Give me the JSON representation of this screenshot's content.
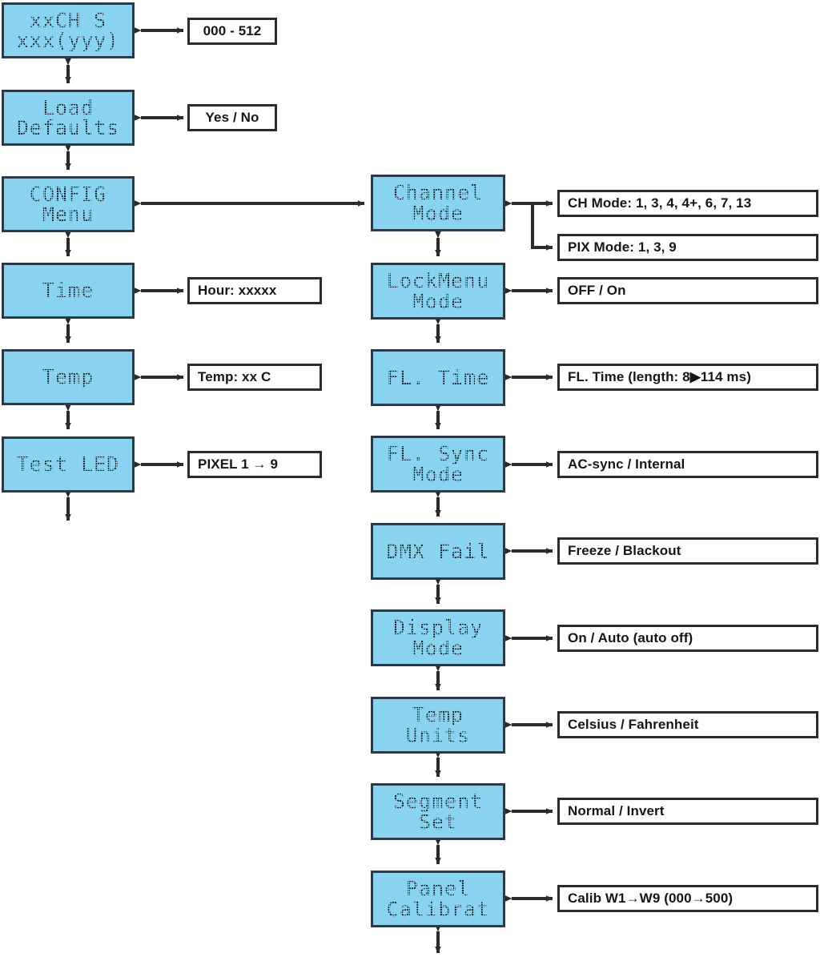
{
  "diagram": {
    "title": "DMX LED panel menu navigation map",
    "colors": {
      "lcd_fill": "#87d3f0",
      "lcd_border": "#2b3a46",
      "lcd_text": "#1d2630",
      "value_border": "#2b2b2b",
      "value_text": "#161616",
      "wire": "#2b2b2b",
      "background": "#ffffff"
    },
    "left_column": [
      {
        "id": "dmx-address",
        "lines": [
          "xxCH S",
          "xxx(yyy)"
        ],
        "value": "000 - 512",
        "value_align": "center"
      },
      {
        "id": "load-defaults",
        "lines": [
          "Load",
          "Defaults"
        ],
        "value": "Yes / No",
        "value_align": "center"
      },
      {
        "id": "config-menu",
        "lines": [
          "CONFIG",
          "Menu"
        ],
        "value": null,
        "value_align": null
      },
      {
        "id": "time",
        "lines": [
          "Time"
        ],
        "value": "Hour: xxxxx",
        "value_align": "left"
      },
      {
        "id": "temp",
        "lines": [
          "Temp"
        ],
        "value": "Temp: xx C",
        "value_align": "left"
      },
      {
        "id": "test-led",
        "lines": [
          "Test LED"
        ],
        "value": "PIXEL 1 → 9",
        "value_align": "left"
      }
    ],
    "right_column": [
      {
        "id": "channel-mode",
        "lines": [
          "Channel",
          "Mode"
        ],
        "values": [
          "CH Mode: 1, 3, 4, 4+, 6, 7, 13",
          "PIX Mode: 1, 3, 9"
        ]
      },
      {
        "id": "lockmenu-mode",
        "lines": [
          "LockMenu",
          "Mode"
        ],
        "values": [
          "OFF / On"
        ]
      },
      {
        "id": "fl-time",
        "lines": [
          "FL. Time"
        ],
        "values": [
          "FL. Time (length: 8▶114 ms)"
        ]
      },
      {
        "id": "fl-sync-mode",
        "lines": [
          "FL. Sync",
          "Mode"
        ],
        "values": [
          "AC-sync / Internal"
        ]
      },
      {
        "id": "dmx-fail",
        "lines": [
          "DMX Fail"
        ],
        "values": [
          "Freeze / Blackout"
        ]
      },
      {
        "id": "display-mode",
        "lines": [
          "Display",
          "Mode"
        ],
        "values": [
          "On / Auto (auto off)"
        ]
      },
      {
        "id": "temp-units",
        "lines": [
          "Temp",
          "Units"
        ],
        "values": [
          "Celsius / Fahrenheit"
        ]
      },
      {
        "id": "segment-set",
        "lines": [
          "Segment",
          "Set"
        ],
        "values": [
          "Normal / Invert"
        ]
      },
      {
        "id": "panel-calibrat",
        "lines": [
          "Panel",
          "Calibrat"
        ],
        "values": [
          "Calib W1→W9   (000→500)"
        ]
      }
    ]
  }
}
